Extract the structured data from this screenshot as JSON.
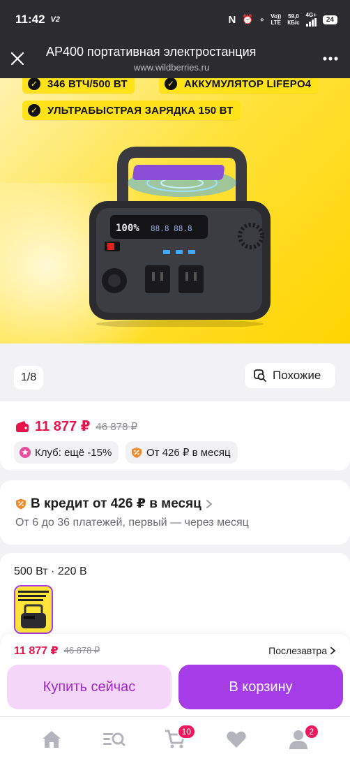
{
  "status_bar": {
    "time": "11:42",
    "carrier_tag": "V2",
    "net_speed": "59,0",
    "net_unit": "КБ/с",
    "volte": "Vo))",
    "lte": "LTE",
    "gen": "4G+",
    "battery": "24"
  },
  "browser": {
    "title": "АР400 портативная электростанция",
    "url": "www.wildberries.ru"
  },
  "hero": {
    "badges": [
      "346 ВТЧ/500 ВТ",
      "АККУМУЛЯТОР LIFEPO4",
      "УЛЬТРАБЫСТРАЯ ЗАРЯДКА 150 ВТ"
    ],
    "counter": "1/8",
    "similar_label": "Похожие"
  },
  "price": {
    "current": "11 877 ₽",
    "old": "46 878 ₽",
    "club_label": "Клуб: ещё -15%",
    "monthly_label": "От 426 ₽ в месяц"
  },
  "credit": {
    "title": "В кредит от 426 ₽ в месяц",
    "subtitle": "От 6 до 36 платежей, первый — через месяц"
  },
  "variant": {
    "label": "500 Вт · 220 В"
  },
  "purchase": {
    "price": "11 877 ₽",
    "old_price": "46 878 ₽",
    "delivery": "Послезавтра",
    "buy_now": "Купить сейчас",
    "add_to_cart": "В корзину"
  },
  "nav": {
    "cart_count": "10",
    "profile_count": "2"
  },
  "colors": {
    "accent": "#a63be8",
    "price": "#e6144b",
    "hero_yellow": "#ffd400"
  }
}
